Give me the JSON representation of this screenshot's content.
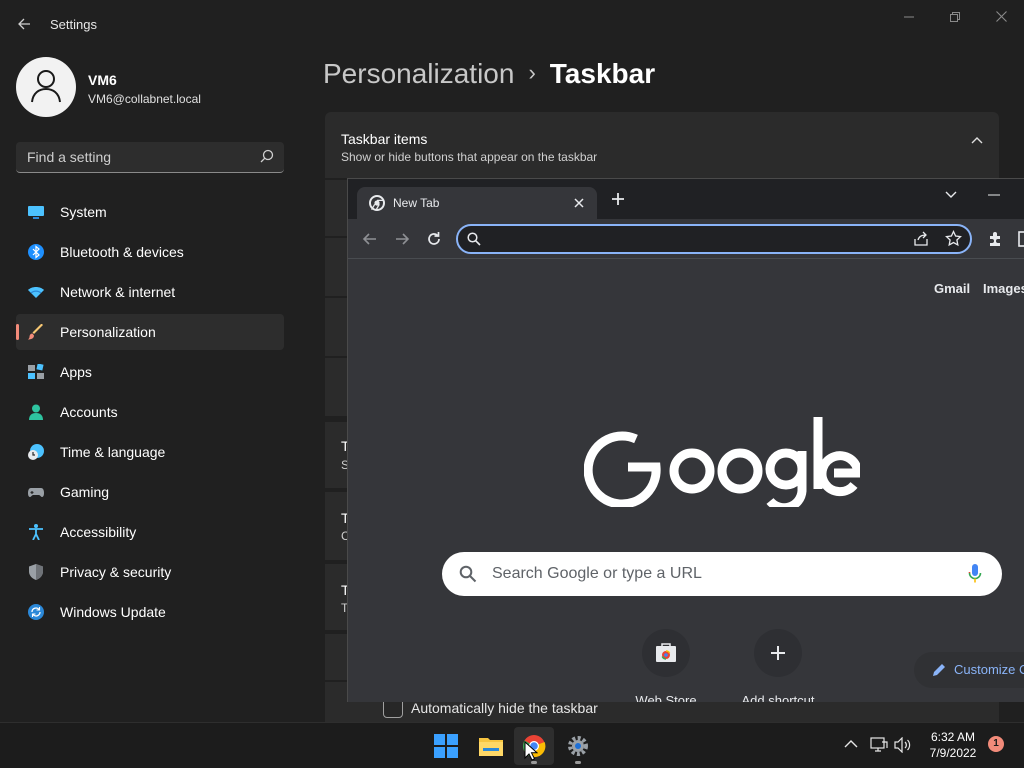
{
  "settings": {
    "app_title": "Settings",
    "user": {
      "name": "VM6",
      "email": "VM6@collabnet.local"
    },
    "search": {
      "placeholder": "Find a setting"
    },
    "nav": [
      {
        "label": "System",
        "icon": "monitor-icon"
      },
      {
        "label": "Bluetooth & devices",
        "icon": "bluetooth-icon"
      },
      {
        "label": "Network & internet",
        "icon": "wifi-icon"
      },
      {
        "label": "Personalization",
        "icon": "brush-icon",
        "active": true
      },
      {
        "label": "Apps",
        "icon": "apps-icon"
      },
      {
        "label": "Accounts",
        "icon": "person-icon"
      },
      {
        "label": "Time & language",
        "icon": "clock-globe-icon"
      },
      {
        "label": "Gaming",
        "icon": "gamepad-icon"
      },
      {
        "label": "Accessibility",
        "icon": "accessibility-icon"
      },
      {
        "label": "Privacy & security",
        "icon": "shield-icon"
      },
      {
        "label": "Windows Update",
        "icon": "update-icon"
      }
    ],
    "breadcrumb": {
      "parent": "Personalization",
      "separator": "›",
      "current": "Taskbar"
    },
    "taskbar_items": {
      "title": "Taskbar items",
      "subtitle": "Show or hide buttons that appear on the taskbar"
    },
    "partial_rows": [
      {
        "title": "T",
        "sub": "S"
      },
      {
        "title": "T",
        "sub": "C"
      },
      {
        "title": "T",
        "sub": "T"
      }
    ],
    "autohide_label": "Automatically hide the taskbar"
  },
  "chrome": {
    "tab_title": "New Tab",
    "omnibox_value": "",
    "links": {
      "gmail": "Gmail",
      "images": "Images"
    },
    "search_placeholder": "Search Google or type a URL",
    "shortcuts": [
      {
        "label": "Web Store"
      },
      {
        "label": "Add shortcut"
      }
    ],
    "customize_label": "Customize C"
  },
  "taskbar": {
    "time": "6:32 AM",
    "date": "7/9/2022",
    "notification_count": "1"
  },
  "colors": {
    "accent": "#f28b7a",
    "chrome_focus": "#8ab4f8"
  }
}
